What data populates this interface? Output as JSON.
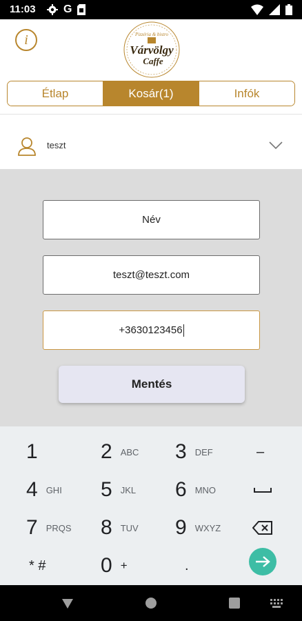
{
  "status_bar": {
    "time": "11:03",
    "left_icons": [
      "gear-icon",
      "google-g-icon",
      "sim-card-icon"
    ],
    "right_icons": [
      "wifi-icon",
      "signal-icon",
      "battery-icon"
    ]
  },
  "header": {
    "logo_icon": "varvolgy-caffe-logo",
    "logo_top": "Pizzéria & bistro",
    "logo_main": "Várvölgy",
    "logo_sub": "Caffe",
    "info_icon": "i"
  },
  "tabs": [
    {
      "label": "Étlap",
      "active": false
    },
    {
      "label": "Kosár(1)",
      "active": true
    },
    {
      "label": "Infók",
      "active": false
    }
  ],
  "user": {
    "name": "teszt"
  },
  "form": {
    "name_value": "Név",
    "email_value": "teszt@teszt.com",
    "phone_value": "+3630123456",
    "save_label": "Mentés"
  },
  "keyboard": {
    "rows": [
      [
        {
          "num": "1",
          "letters": ""
        },
        {
          "num": "2",
          "letters": "ABC"
        },
        {
          "num": "3",
          "letters": "DEF"
        },
        {
          "sym": "–"
        }
      ],
      [
        {
          "num": "4",
          "letters": "GHI"
        },
        {
          "num": "5",
          "letters": "JKL"
        },
        {
          "num": "6",
          "letters": "MNO"
        },
        {
          "sym": "space"
        }
      ],
      [
        {
          "num": "7",
          "letters": "PRQS"
        },
        {
          "num": "8",
          "letters": "TUV"
        },
        {
          "num": "9",
          "letters": "WXYZ"
        },
        {
          "sym": "backspace"
        }
      ],
      [
        {
          "sym": "* #"
        },
        {
          "num": "0",
          "letters": "+"
        },
        {
          "sym": "."
        },
        {
          "sym": "go"
        }
      ]
    ]
  },
  "colors": {
    "accent": "#b8862d",
    "form_bg": "#dcdcdc",
    "go_button": "#3dbda5"
  }
}
